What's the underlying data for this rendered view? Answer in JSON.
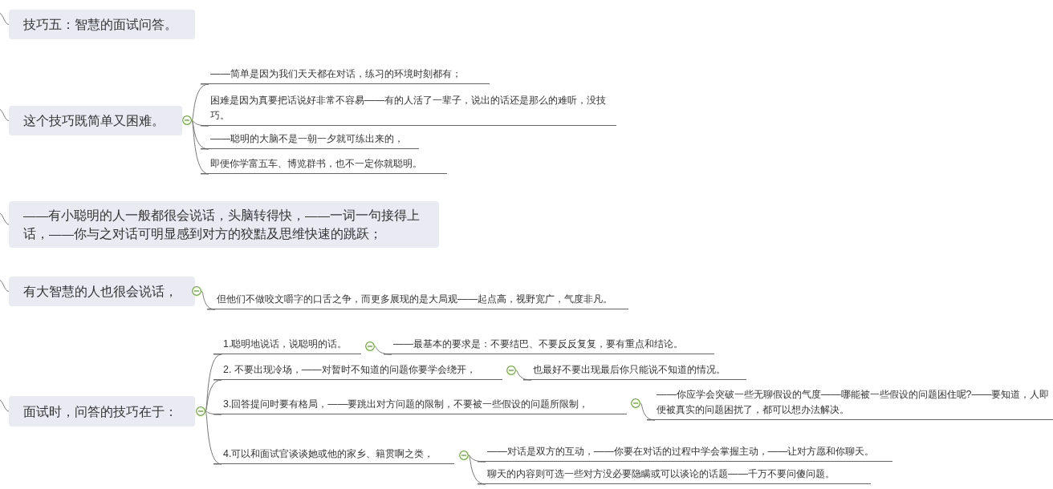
{
  "topics": [
    {
      "text": "技巧五：智慧的面试问答。"
    },
    {
      "text": "这个技巧既简单又困难。",
      "expanded": true,
      "children": [
        {
          "text": "——简单是因为我们天天都在对话，练习的环境时刻都有；"
        },
        {
          "text": "困难是因为真要把话说好非常不容易——有的人活了一辈子，说出的话还是那么的难听，没技巧。"
        },
        {
          "text": "——聪明的大脑不是一朝一夕就可练出来的，"
        },
        {
          "text": "即便你学富五车、博览群书，也不一定你就聪明。"
        }
      ]
    },
    {
      "text": "——有小聪明的人一般都很会说话，头脑转得快，——一词一句接得上话，——你与之对话可明显感到对方的狡黠及思维快速的跳跃；"
    },
    {
      "text": "有大智慧的人也很会说话，",
      "expanded": true,
      "children": [
        {
          "text": "但他们不做咬文嚼字的口舌之争，而更多展现的是大局观——起点高，视野宽广，气度非凡。"
        }
      ]
    },
    {
      "text": "面试时，问答的技巧在于：",
      "expanded": true,
      "children": [
        {
          "text": "1.聪明地说话，说聪明的话。",
          "expanded": true,
          "children": [
            {
              "text": "——最基本的要求是：不要结巴、不要反反复复，要有重点和结论。"
            }
          ]
        },
        {
          "text": "2. 不要出现冷场，——对暂时不知道的问题你要学会绕开，",
          "expanded": true,
          "children": [
            {
              "text": "也最好不要出现最后你只能说不知道的情况。"
            }
          ]
        },
        {
          "text": "3.回答提问时要有格局，——要跳出对方问题的限制，不要被一些假设的问题所限制，",
          "expanded": true,
          "children": [
            {
              "text": "——你应学会突破一些无聊假设的气度——哪能被一些假设的问题困住呢?——要知道，人即便被真实的问题困扰了，都可以想办法解决。"
            }
          ]
        },
        {
          "text": "4.可以和面试官谈谈她或他的家乡、籍贯啊之类，",
          "expanded": true,
          "children": [
            {
              "text": "——对话是双方的互动，——你要在对话的过程中学会掌握主动，——让对方愿和你聊天。"
            },
            {
              "text": "聊天的内容则可选一些对方没必要隐瞒或可以谈论的话题——千万不要问傻问题。"
            }
          ]
        }
      ]
    }
  ]
}
